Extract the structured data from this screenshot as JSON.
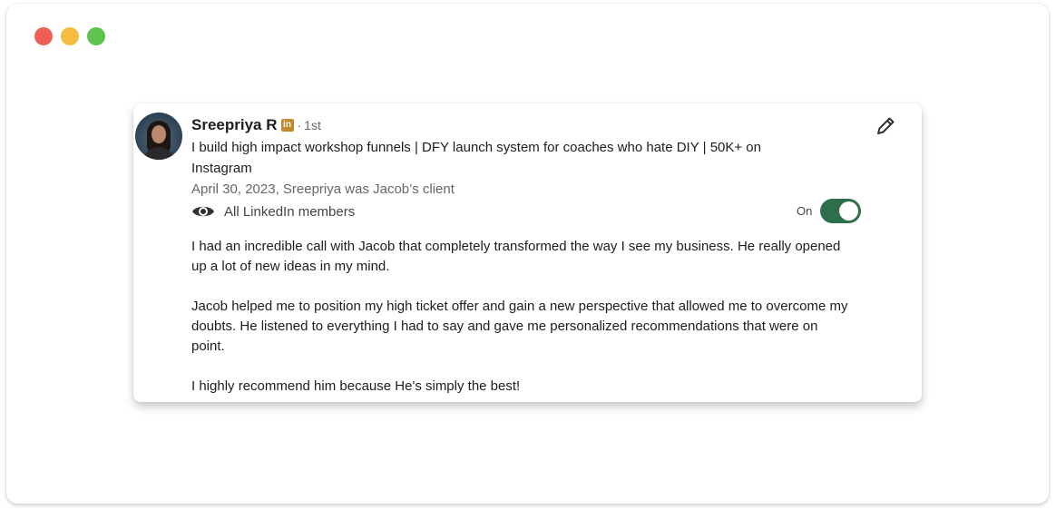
{
  "window": {
    "controls": [
      "close",
      "minimize",
      "zoom"
    ]
  },
  "recommendation": {
    "author": {
      "name": "Sreepriya R",
      "badge": "in",
      "separator": "·",
      "degree": "1st",
      "headline": "I build high impact workshop funnels | DFY launch system for coaches who hate DIY | 50K+ on Instagram"
    },
    "meta": "April 30, 2023, Sreepriya was Jacob’s client",
    "visibility": {
      "icon": "eye-icon",
      "label": "All LinkedIn members"
    },
    "toggle": {
      "label": "On",
      "state": true,
      "color": "#2f6e4a"
    },
    "edit_icon": "pencil-icon",
    "body": [
      "I had an incredible call with Jacob that completely transformed the way I see my business. He really opened up a lot of new ideas in my mind.",
      "Jacob helped me to position my high ticket offer and gain a new perspective that allowed me to overcome my doubts. He listened to everything I had to say and gave me personalized recommendations that were on point.",
      "I highly recommend him because He's simply the best!"
    ]
  }
}
